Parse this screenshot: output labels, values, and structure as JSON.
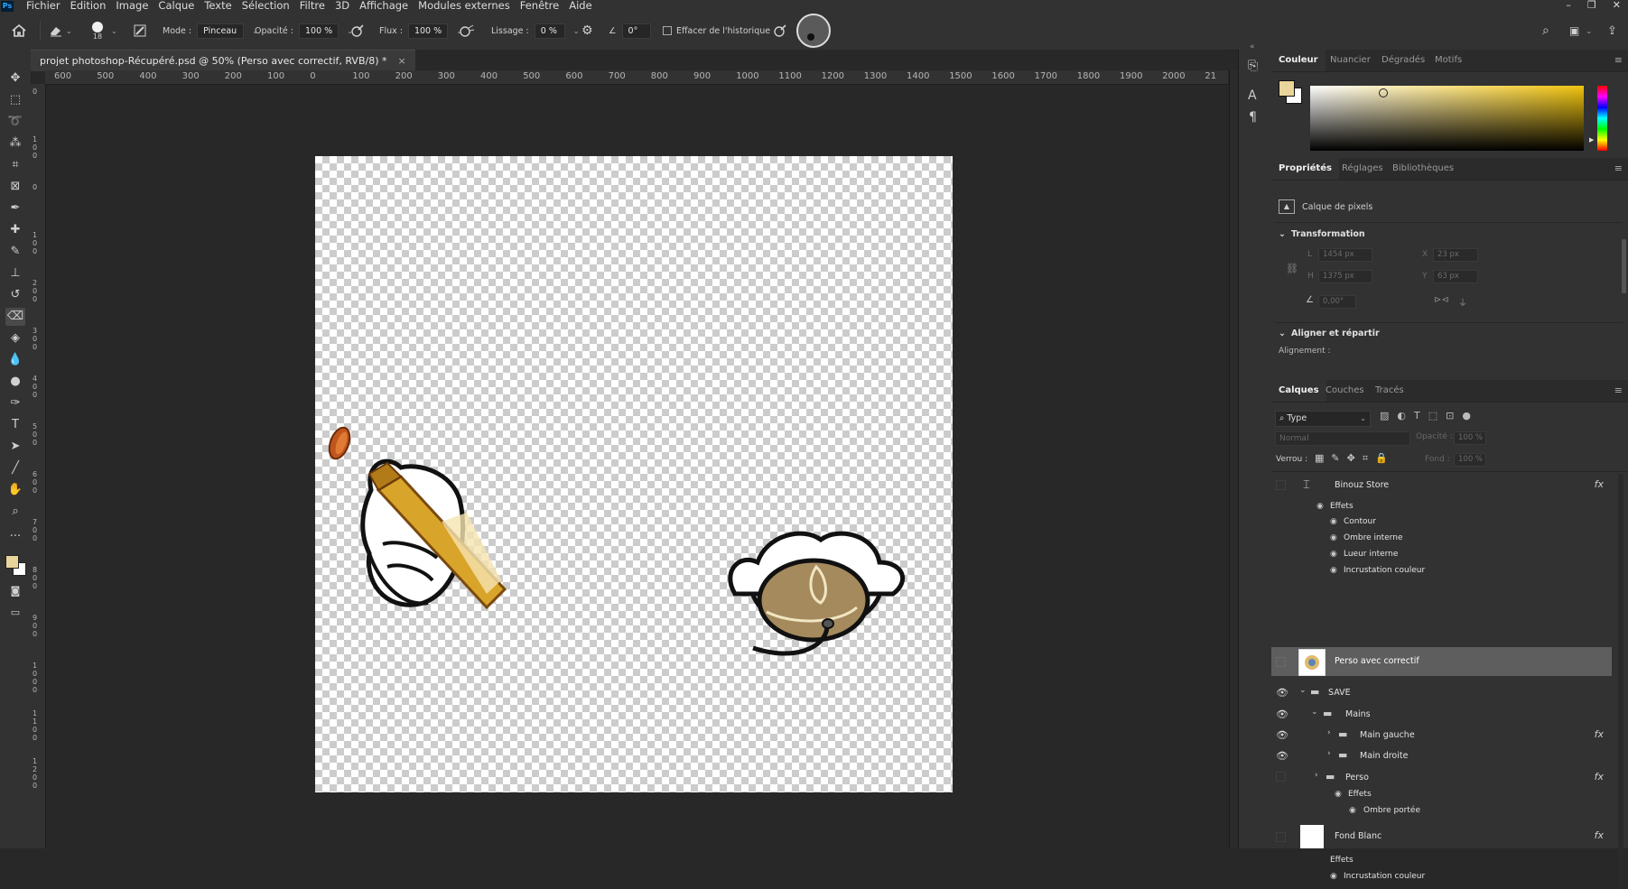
{
  "app": {
    "logo": "Ps"
  },
  "menu": [
    "Fichier",
    "Edition",
    "Image",
    "Calque",
    "Texte",
    "Sélection",
    "Filtre",
    "3D",
    "Affichage",
    "Modules externes",
    "Fenêtre",
    "Aide"
  ],
  "window_controls": [
    "–",
    "❐",
    "✕"
  ],
  "options": {
    "brush_size": "18",
    "mode_label": "Mode :",
    "mode_value": "Pinceau",
    "opacity_label": "Opacité :",
    "opacity_value": "100 %",
    "flux_label": "Flux :",
    "flux_value": "100 %",
    "smoothing_label": "Lissage :",
    "smoothing_value": "0 %",
    "angle_value": "0°",
    "erase_history_label": "Effacer de l'historique"
  },
  "document": {
    "tab_title": "projet photoshop-Récupéré.psd @ 50% (Perso avec correctif, RVB/8) *",
    "close": "×"
  },
  "ruler": {
    "h": [
      "600",
      "500",
      "400",
      "300",
      "200",
      "100",
      "0",
      "100",
      "200",
      "300",
      "400",
      "500",
      "600",
      "700",
      "800",
      "900",
      "1000",
      "1100",
      "1200",
      "1300",
      "1400",
      "1500",
      "1600",
      "1700",
      "1800",
      "1900",
      "2000",
      "21"
    ],
    "v": [
      "0",
      "100",
      "0",
      "100",
      "200",
      "300",
      "400",
      "500",
      "600",
      "700",
      "800",
      "900",
      "1000",
      "1100",
      "1200"
    ]
  },
  "color_panel": {
    "tabs": [
      "Couleur",
      "Nuancier",
      "Dégradés",
      "Motifs"
    ],
    "fg_color": "#e9d59b",
    "bg_color": "#ffffff",
    "field_hue": "#f1c40f"
  },
  "properties_panel": {
    "tabs": [
      "Propriétés",
      "Réglages",
      "Bibliothèques"
    ],
    "layer_kind": "Calque de pixels",
    "transform_title": "Transformation",
    "w_label": "L",
    "w_value": "1454 px",
    "h_label": "H",
    "h_value": "1375 px",
    "x_label": "X",
    "x_value": "23 px",
    "y_label": "Y",
    "y_value": "63 px",
    "angle_value": "0,00°",
    "align_title": "Aligner et répartir",
    "align_label": "Alignement :"
  },
  "layers_panel": {
    "tabs": [
      "Calques",
      "Couches",
      "Tracés"
    ],
    "filter_label": "Type",
    "blend_mode": "Normal",
    "opacity_label": "Opacité :",
    "opacity_value": "100 %",
    "lock_label": "Verrou :",
    "fill_label": "Fond :",
    "fill_value": "100 %",
    "layers": [
      {
        "name": "Binouz Store"
      },
      {
        "name": "Effets"
      },
      {
        "name": "Contour"
      },
      {
        "name": "Ombre interne"
      },
      {
        "name": "Lueur interne"
      },
      {
        "name": "Incrustation couleur"
      },
      {
        "name": "Perso avec correctif"
      },
      {
        "name": "SAVE"
      },
      {
        "name": "Mains"
      },
      {
        "name": "Main gauche"
      },
      {
        "name": "Main droite"
      },
      {
        "name": "Perso"
      },
      {
        "name": "Effets"
      },
      {
        "name": "Ombre portée"
      },
      {
        "name": "Fond Blanc"
      },
      {
        "name": "Effets"
      },
      {
        "name": "Incrustation couleur"
      }
    ],
    "fx": "fx"
  },
  "icons": [
    "home-icon",
    "eraser-icon",
    "brush-preset-icon",
    "airbrush-icon",
    "settings-icon",
    "angle-icon",
    "pressure-icon",
    "search-icon",
    "workspace-icon",
    "share-icon"
  ]
}
